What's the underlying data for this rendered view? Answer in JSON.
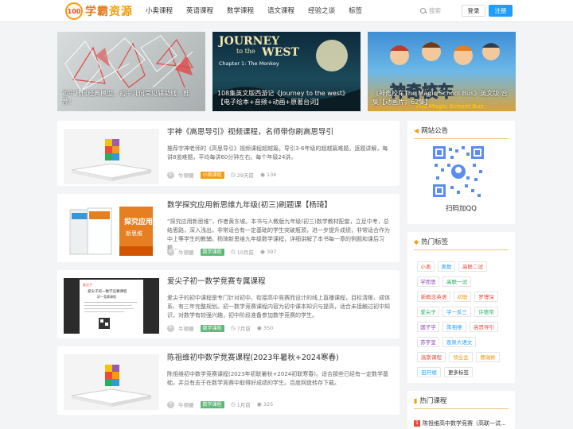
{
  "header": {
    "logo_badge": "100",
    "logo_text_a": "学霸",
    "logo_text_b": "资源",
    "nav": [
      "小奥课程",
      "英语课程",
      "数学课程",
      "语文课程",
      "经验之谈",
      "标签"
    ],
    "search_placeholder": "搜索",
    "login_label": "登录",
    "register_label": "注册"
  },
  "slides": [
    {
      "caption": "初中几何经典模型，初中几何常见辅助线，推荐！"
    },
    {
      "caption": "108集英文版西游记《Journey to the west》【电子绘本+音频+动画+原著台词】",
      "poster_title": "JOURNEY",
      "poster_sub": "to the",
      "poster_title2": "WEST",
      "poster_chapter": "Chapter 1: The Monkey"
    },
    {
      "caption": "《神奇校车The Magic School Bus》英文版 合集【动画片，62集】",
      "poster_text": "神奇校车",
      "poster_sub": "The Magic School Bus"
    }
  ],
  "articles": [
    {
      "title": "宇神《高思导引》视频课程，名师带你刷高思导引",
      "desc": "推荐宇神老师的《高思导引》视频课程超越篇，导引3-6年级的超越篇难题，逐题讲解，每讲8道难题，平均每讲60分钟左右。每个年级24讲。",
      "author": "牛顿圈",
      "tag": "小奥课程",
      "time": "29天前",
      "views": "136"
    },
    {
      "title": "数学探究应用新思维九年级(初三)刷题课【杨琦】",
      "desc": "“探究应用新思维”，作者黄东坡。本书与人教版九年级(初三)数学教材配套，立足中考，总结思路，深入浅出，非常适合有一定基础的学生突破瓶颈，进一步提升成绩，非常适合作为中上等学生的教辅，杨琦新思维九年级数学课程，详细讲解了本书每一章的例题和课后习题...",
      "author": "牛顿圈",
      "tag": "数学课程",
      "time": "10月前",
      "views": "397",
      "book_text": "探究应用",
      "book_sub": "新思维"
    },
    {
      "title": "爱尖子初一数学竞赛专属课程",
      "desc": "爱尖子的初中课程是专门针对初中、衔接高中竞赛而设计的线上直播课程，目标清晰、成体系、有三年完整规划。初一数学竞赛课程内容为初中课本知识与提高，适合未接触过初中知识，对数学有较强兴趣，初中阶段准备参加数学竞赛的学生。",
      "author": "牛顿圈",
      "tag": "数学课程",
      "time": "7月前",
      "views": "350",
      "doc_brand": "爱尖子",
      "doc_heading": "爱尖子初一数学竞赛课程",
      "doc_sub": "初一竞赛课程"
    },
    {
      "title": "陈祖维初中数学竞赛课程(2023年暑秋+2024寒春)",
      "desc": "陈祖维初中数学竞赛课程(2023年初联暑秋+2024初联寒春)。适合那些已经有一定数学基础，并且有志于在数学竞赛中取得好成绩的学生。百度网盘转存下载。",
      "author": "牛顿圈",
      "tag": "数学课程",
      "time": "1月前",
      "views": "325"
    }
  ],
  "sidebar": {
    "notice_title": "网站公告",
    "qr_label": "扫码加QQ",
    "tags_title": "热门标签",
    "tags": [
      {
        "label": "小奥",
        "color": "#e74c3c"
      },
      {
        "label": "奥数",
        "color": "#1e9fff"
      },
      {
        "label": "高联二试",
        "color": "#e74c3c"
      },
      {
        "label": "学而思",
        "color": "#8e44ad"
      },
      {
        "label": "高联一试",
        "color": "#27ae60"
      },
      {
        "label": "新概念英语",
        "color": "#e74c3c"
      },
      {
        "label": "初联",
        "color": "#f39c12"
      },
      {
        "label": "罗博深",
        "color": "#e74c3c"
      },
      {
        "label": "爱尖子",
        "color": "#27ae60"
      },
      {
        "label": "学一反三",
        "color": "#1e9fff"
      },
      {
        "label": "许德常",
        "color": "#27ae60"
      },
      {
        "label": "国子学",
        "color": "#8e44ad"
      },
      {
        "label": "陈祖维",
        "color": "#1e9fff"
      },
      {
        "label": "高思导引",
        "color": "#e74c3c"
      },
      {
        "label": "苏宇坚",
        "color": "#8e44ad"
      },
      {
        "label": "恩泉大语文",
        "color": "#1e9fff"
      },
      {
        "label": "高斯课程",
        "color": "#e74c3c"
      },
      {
        "label": "领全会",
        "color": "#f39c12"
      },
      {
        "label": "曹瑞彬",
        "color": "#f39c12"
      },
      {
        "label": "田开斌",
        "color": "#1e9fff"
      },
      {
        "label": "更多标签",
        "color": "#333333"
      }
    ],
    "hot_title": "热门课程",
    "hot_items": [
      {
        "num": "1",
        "label": "陈祖维高中数学竞赛（高联一试..."
      }
    ]
  },
  "colors": {
    "accent": "#f39c12",
    "primary": "#1e9fff"
  }
}
